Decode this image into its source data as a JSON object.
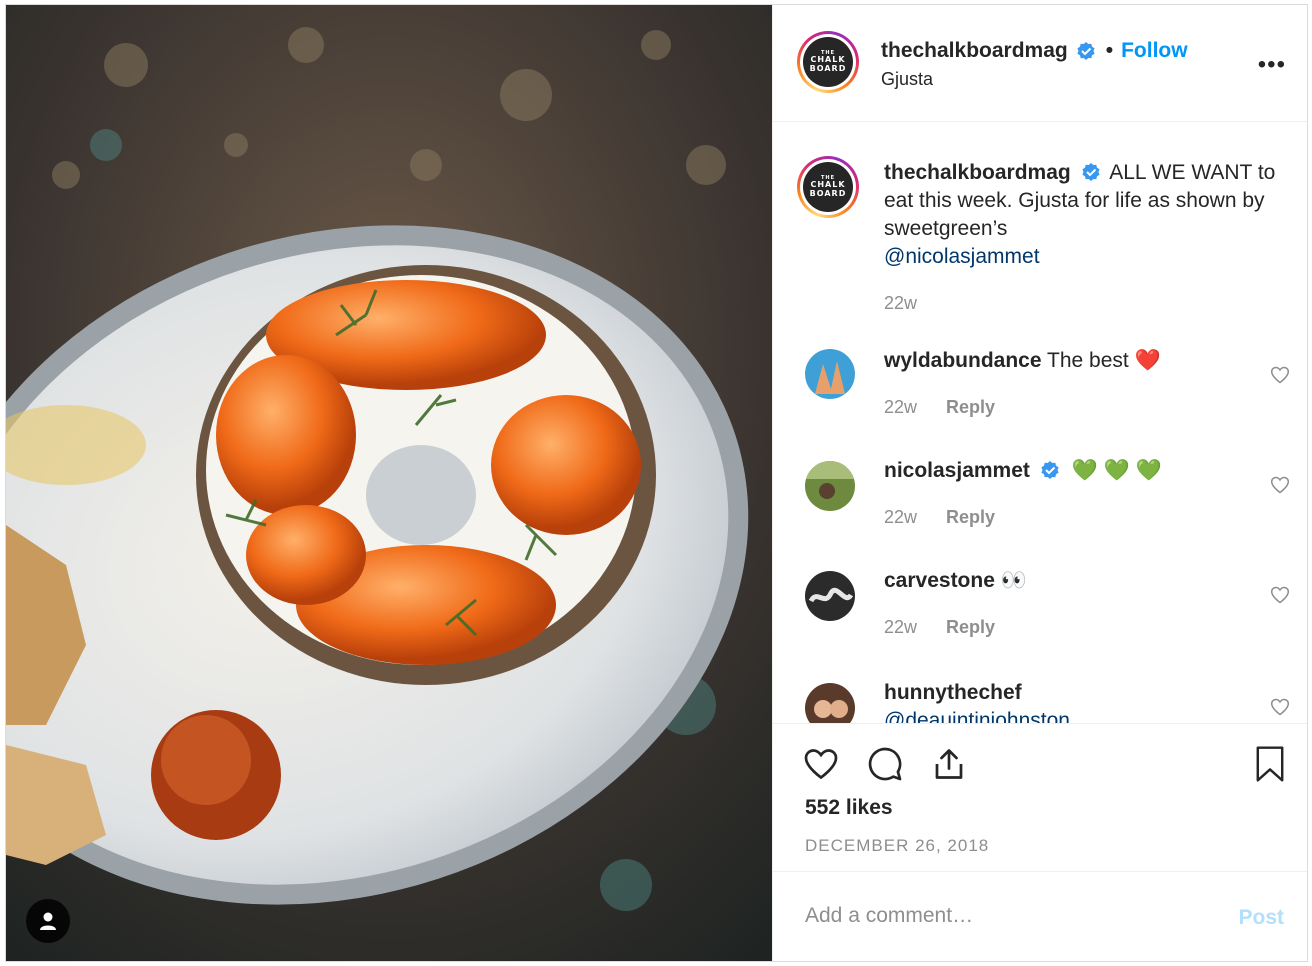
{
  "post": {
    "username": "thechalkboardmag",
    "location": "Gjusta",
    "follow_label": "Follow",
    "separator": "•",
    "more_label": "•••",
    "logo_text_top": "THE",
    "logo_text_mid": "CHALK",
    "logo_text_bot": "BOARD"
  },
  "caption": {
    "username": "thechalkboardmag",
    "text": "ALL WE WANT to eat this week. Gjusta for life as shown by sweetgreen’s",
    "mention": "@nicolasjammet",
    "time": "22w"
  },
  "comments": [
    {
      "username": "wyldabundance",
      "text": "The best",
      "emoji": "❤️",
      "time": "22w",
      "reply": "Reply",
      "verified": false
    },
    {
      "username": "nicolasjammet",
      "text": "",
      "emoji": "💚 💚 💚",
      "time": "22w",
      "reply": "Reply",
      "verified": true
    },
    {
      "username": "carvestone",
      "text": "",
      "emoji": "👀",
      "time": "22w",
      "reply": "Reply",
      "verified": false
    },
    {
      "username": "hunnythechef",
      "text": "@deauintinjohnston",
      "emoji": "",
      "time": "",
      "reply": "",
      "verified": false
    }
  ],
  "footer": {
    "likes": "552 likes",
    "date": "DECEMBER 26, 2018",
    "comment_placeholder": "Add a comment…",
    "post_label": "Post"
  },
  "colors": {
    "link_blue": "#0095f6",
    "mention_blue": "#00376b",
    "muted": "#8e8e8e",
    "post_disabled": "#b2dffc",
    "verified": "#3897f0"
  }
}
